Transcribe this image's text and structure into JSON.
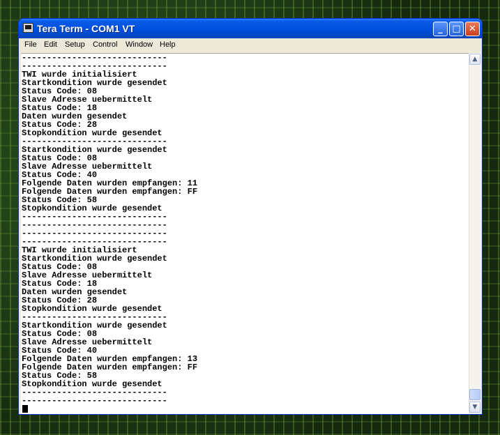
{
  "window": {
    "title": "Tera Term - COM1 VT",
    "controls": {
      "minimize": "_",
      "maximize": "□",
      "close": "✕"
    }
  },
  "menu": [
    "File",
    "Edit",
    "Setup",
    "Control",
    "Window",
    "Help"
  ],
  "terminal": {
    "lines": [
      "-----------------------------",
      "-----------------------------",
      "TWI wurde initialisiert",
      "Startkondition wurde gesendet",
      "Status Code: 08",
      "Slave Adresse uebermittelt",
      "Status Code: 18",
      "Daten wurden gesendet",
      "Status Code: 28",
      "Stopkondition wurde gesendet",
      "-----------------------------",
      "Startkondition wurde gesendet",
      "Status Code: 08",
      "Slave Adresse uebermittelt",
      "Status Code: 40",
      "Folgende Daten wurden empfangen: 11",
      "Folgende Daten wurden empfangen: FF",
      "Status Code: 58",
      "Stopkondition wurde gesendet",
      "-----------------------------",
      "-----------------------------",
      "-----------------------------",
      "-----------------------------",
      "TWI wurde initialisiert",
      "Startkondition wurde gesendet",
      "Status Code: 08",
      "Slave Adresse uebermittelt",
      "Status Code: 18",
      "Daten wurden gesendet",
      "Status Code: 28",
      "Stopkondition wurde gesendet",
      "-----------------------------",
      "Startkondition wurde gesendet",
      "Status Code: 08",
      "Slave Adresse uebermittelt",
      "Status Code: 40",
      "Folgende Daten wurden empfangen: 13",
      "Folgende Daten wurden empfangen: FF",
      "Status Code: 58",
      "Stopkondition wurde gesendet",
      "-----------------------------",
      "-----------------------------"
    ]
  },
  "scrollbar": {
    "up_arrow": "▲",
    "down_arrow": "▼"
  },
  "colors": {
    "title_bar": "#0052e0",
    "close_button": "#c8411c",
    "terminal_bg": "#ffffff",
    "terminal_fg": "#000000"
  }
}
